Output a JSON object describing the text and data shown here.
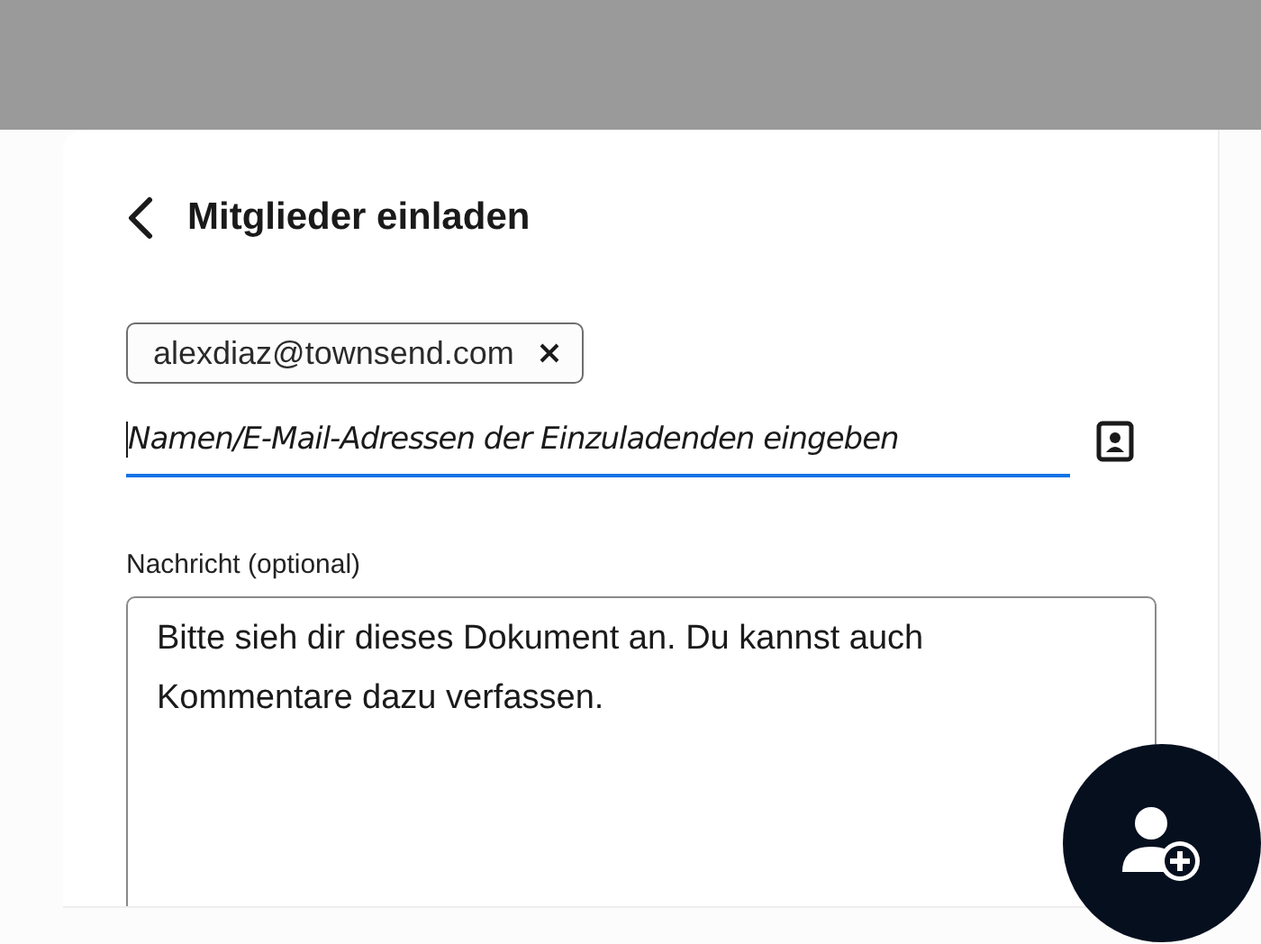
{
  "dialog": {
    "title": "Mitglieder einladen"
  },
  "recipients": [
    {
      "email": "alexdiaz@townsend.com"
    }
  ],
  "invite_field": {
    "placeholder": "Namen/E-Mail-Adressen der Einzuladenden eingeben",
    "focused": true
  },
  "message": {
    "label": "Nachricht (optional)",
    "value": "Bitte sieh dir dieses Dokument an. Du kannst auch Kommentare dazu verfassen."
  }
}
